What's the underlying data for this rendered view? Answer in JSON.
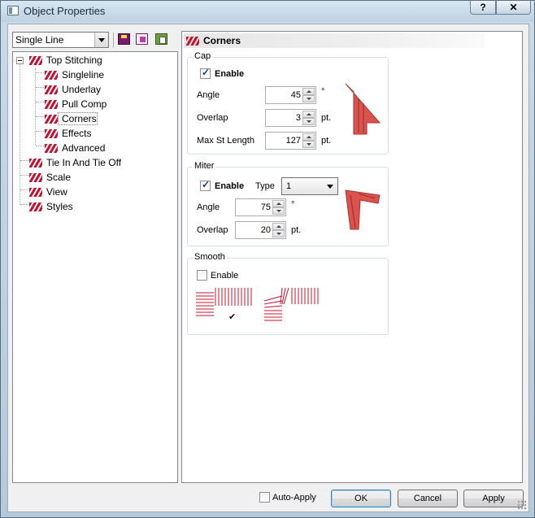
{
  "window": {
    "title": "Object Properties",
    "help_label": "?",
    "close_label": "✕"
  },
  "toolbar": {
    "object_type": "Single Line",
    "icons": [
      "save-icon",
      "copy-icon",
      "paste-icon"
    ]
  },
  "tree": {
    "items": [
      {
        "label": "Top Stitching"
      },
      {
        "label": "Singleline"
      },
      {
        "label": "Underlay"
      },
      {
        "label": "Pull Comp"
      },
      {
        "label": "Corners"
      },
      {
        "label": "Effects"
      },
      {
        "label": "Advanced"
      },
      {
        "label": "Tie In And Tie Off"
      },
      {
        "label": "Scale"
      },
      {
        "label": "View"
      },
      {
        "label": "Styles"
      }
    ],
    "selected": "Corners"
  },
  "panel": {
    "title": "Corners",
    "cap": {
      "title": "Cap",
      "enable_label": "Enable",
      "enabled": true,
      "angle_label": "Angle",
      "angle_value": "45",
      "angle_unit": "°",
      "overlap_label": "Overlap",
      "overlap_value": "3",
      "overlap_unit": "pt.",
      "max_label": "Max St Length",
      "max_value": "127",
      "max_unit": "pt."
    },
    "miter": {
      "title": "Miter",
      "enable_label": "Enable",
      "enabled": true,
      "type_label": "Type",
      "type_value": "1",
      "angle_label": "Angle",
      "angle_value": "75",
      "angle_unit": "°",
      "overlap_label": "Overlap",
      "overlap_value": "20",
      "overlap_unit": "pt."
    },
    "smooth": {
      "title": "Smooth",
      "enable_label": "Enable",
      "enabled": false,
      "selected_mark": "✔"
    }
  },
  "footer": {
    "auto_apply_label": "Auto-Apply",
    "ok_label": "OK",
    "cancel_label": "Cancel",
    "apply_label": "Apply"
  },
  "colors": {
    "stitch": "#c8102e",
    "preview": "#d9534f"
  }
}
